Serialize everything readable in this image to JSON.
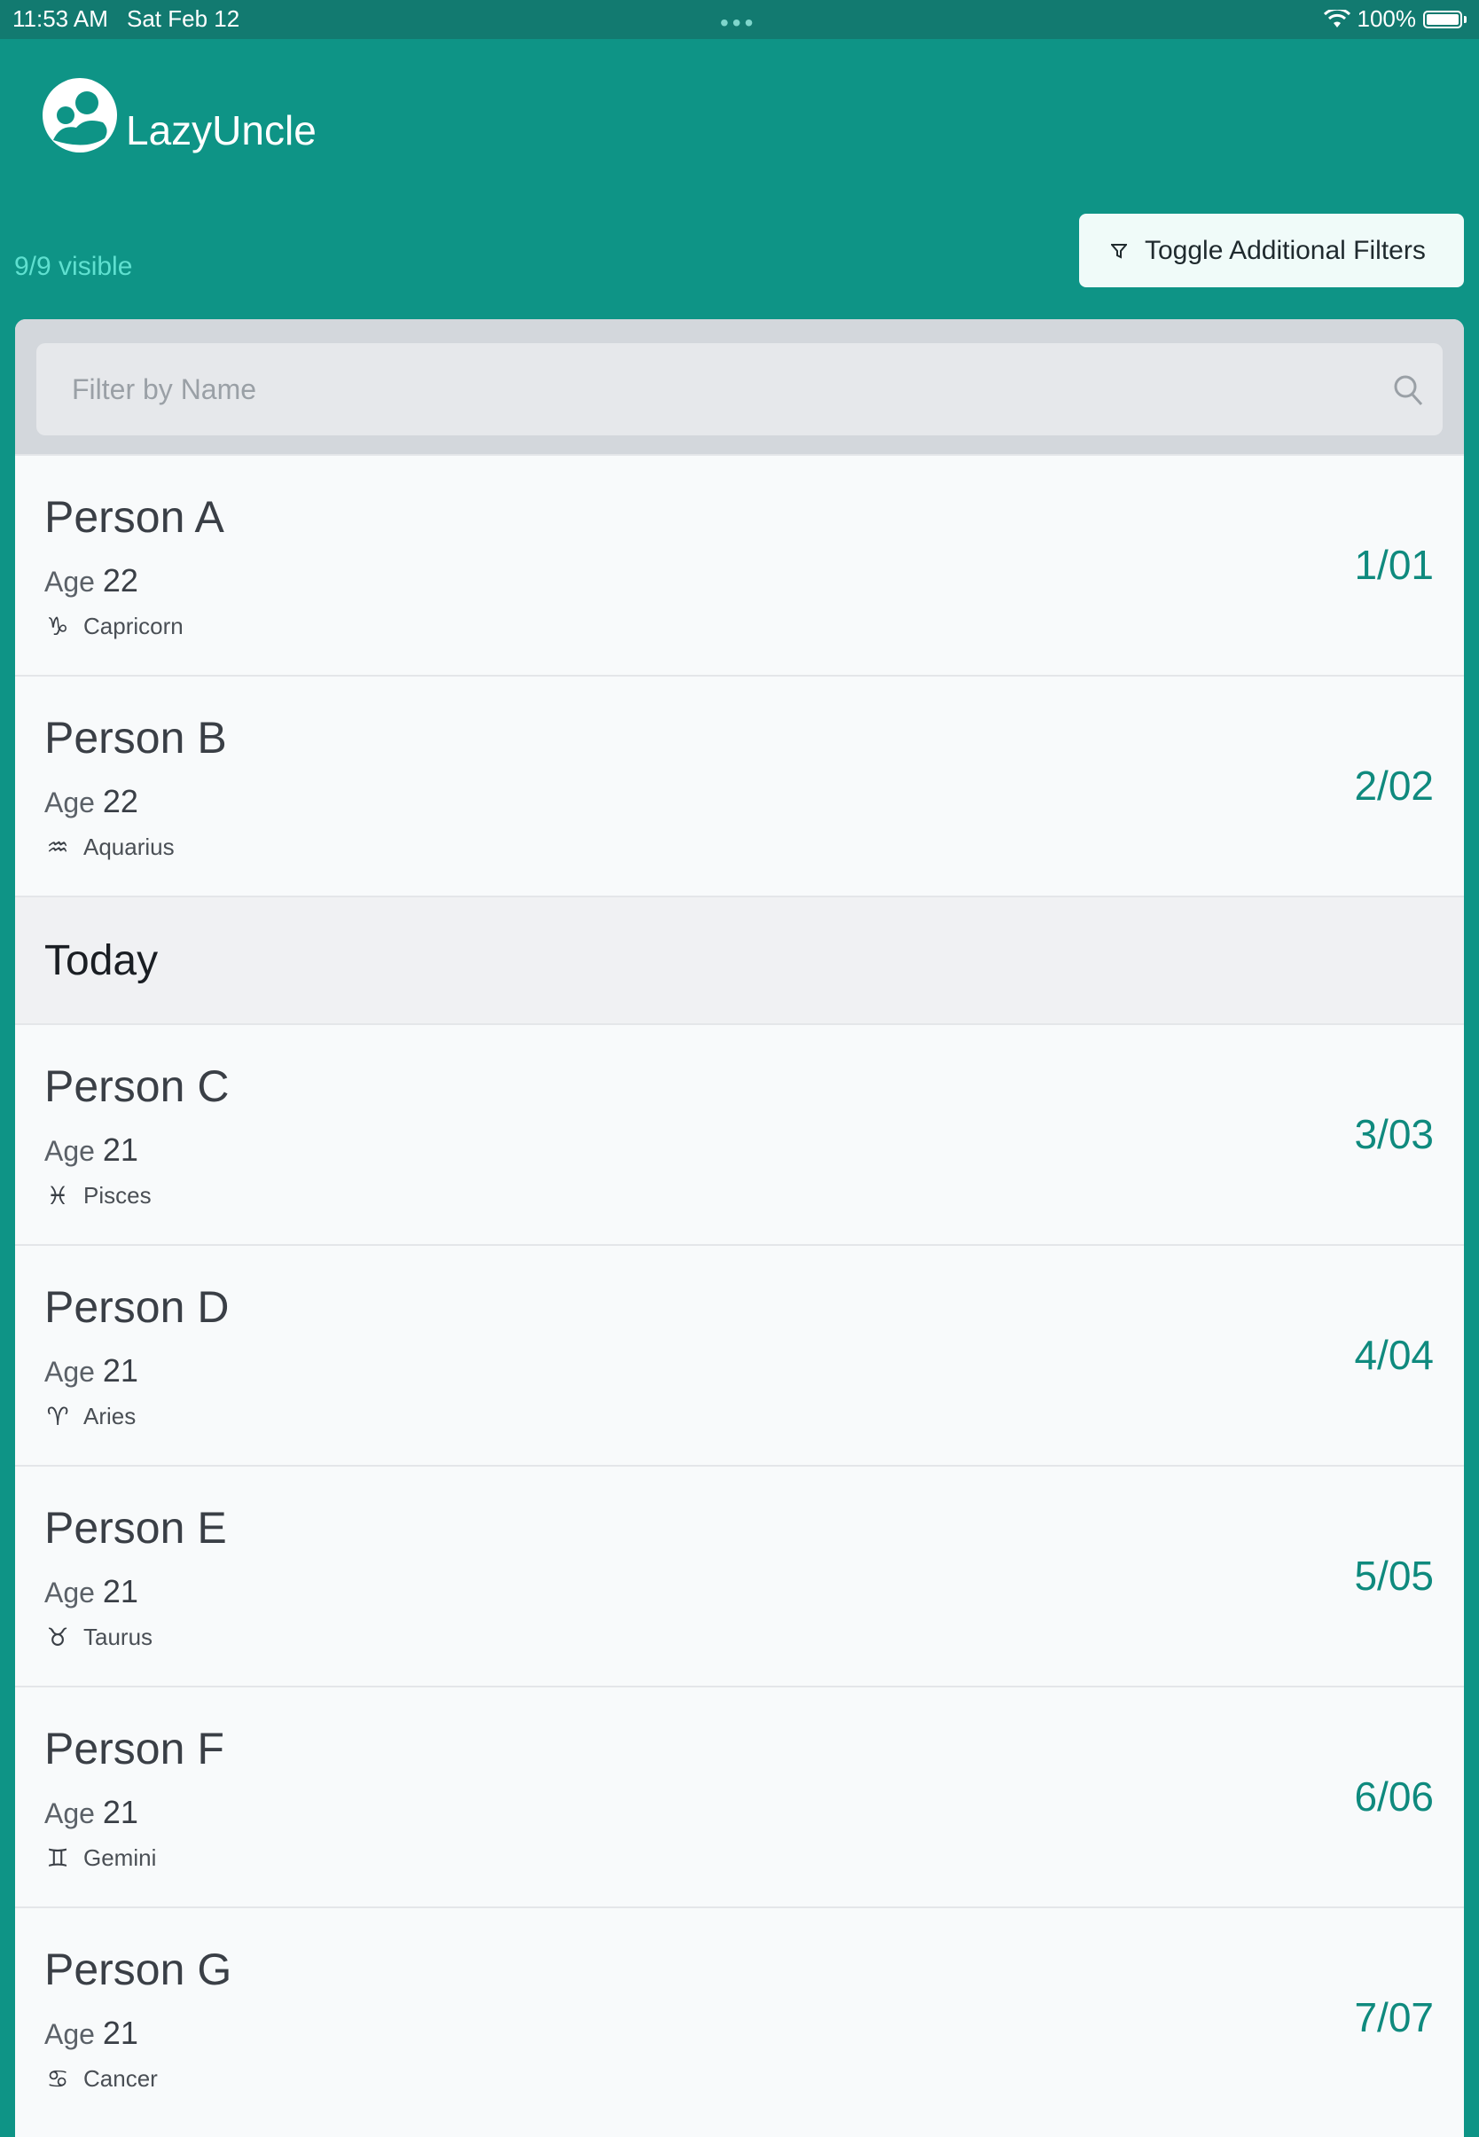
{
  "status_bar": {
    "time": "11:53 AM",
    "date": "Sat Feb 12",
    "battery": "100%",
    "icons": [
      "wifi-icon",
      "battery-icon"
    ]
  },
  "app": {
    "name": "LazyUncle",
    "visible_count": "9/9 visible",
    "toggle_filters_label": "Toggle Additional Filters"
  },
  "search": {
    "placeholder": "Filter by Name"
  },
  "list": {
    "age_label": "Age",
    "before_today": [
      {
        "name": "Person A",
        "age": "22",
        "sign": "Capricorn",
        "sign_glyph": "♑︎",
        "date": "1/01"
      },
      {
        "name": "Person B",
        "age": "22",
        "sign": "Aquarius",
        "sign_glyph": "♒︎",
        "date": "2/02"
      }
    ],
    "section_title": "Today",
    "after_today": [
      {
        "name": "Person C",
        "age": "21",
        "sign": "Pisces",
        "sign_glyph": "♓︎",
        "date": "3/03"
      },
      {
        "name": "Person D",
        "age": "21",
        "sign": "Aries",
        "sign_glyph": "♈︎",
        "date": "4/04"
      },
      {
        "name": "Person E",
        "age": "21",
        "sign": "Taurus",
        "sign_glyph": "♉︎",
        "date": "5/05"
      },
      {
        "name": "Person F",
        "age": "21",
        "sign": "Gemini",
        "sign_glyph": "♊︎",
        "date": "6/06"
      },
      {
        "name": "Person G",
        "age": "21",
        "sign": "Cancer",
        "sign_glyph": "♋︎",
        "date": "7/07"
      }
    ]
  },
  "colors": {
    "brand": "#0e9486",
    "accent": "#0f8a7e",
    "status_bar": "#127a70"
  }
}
